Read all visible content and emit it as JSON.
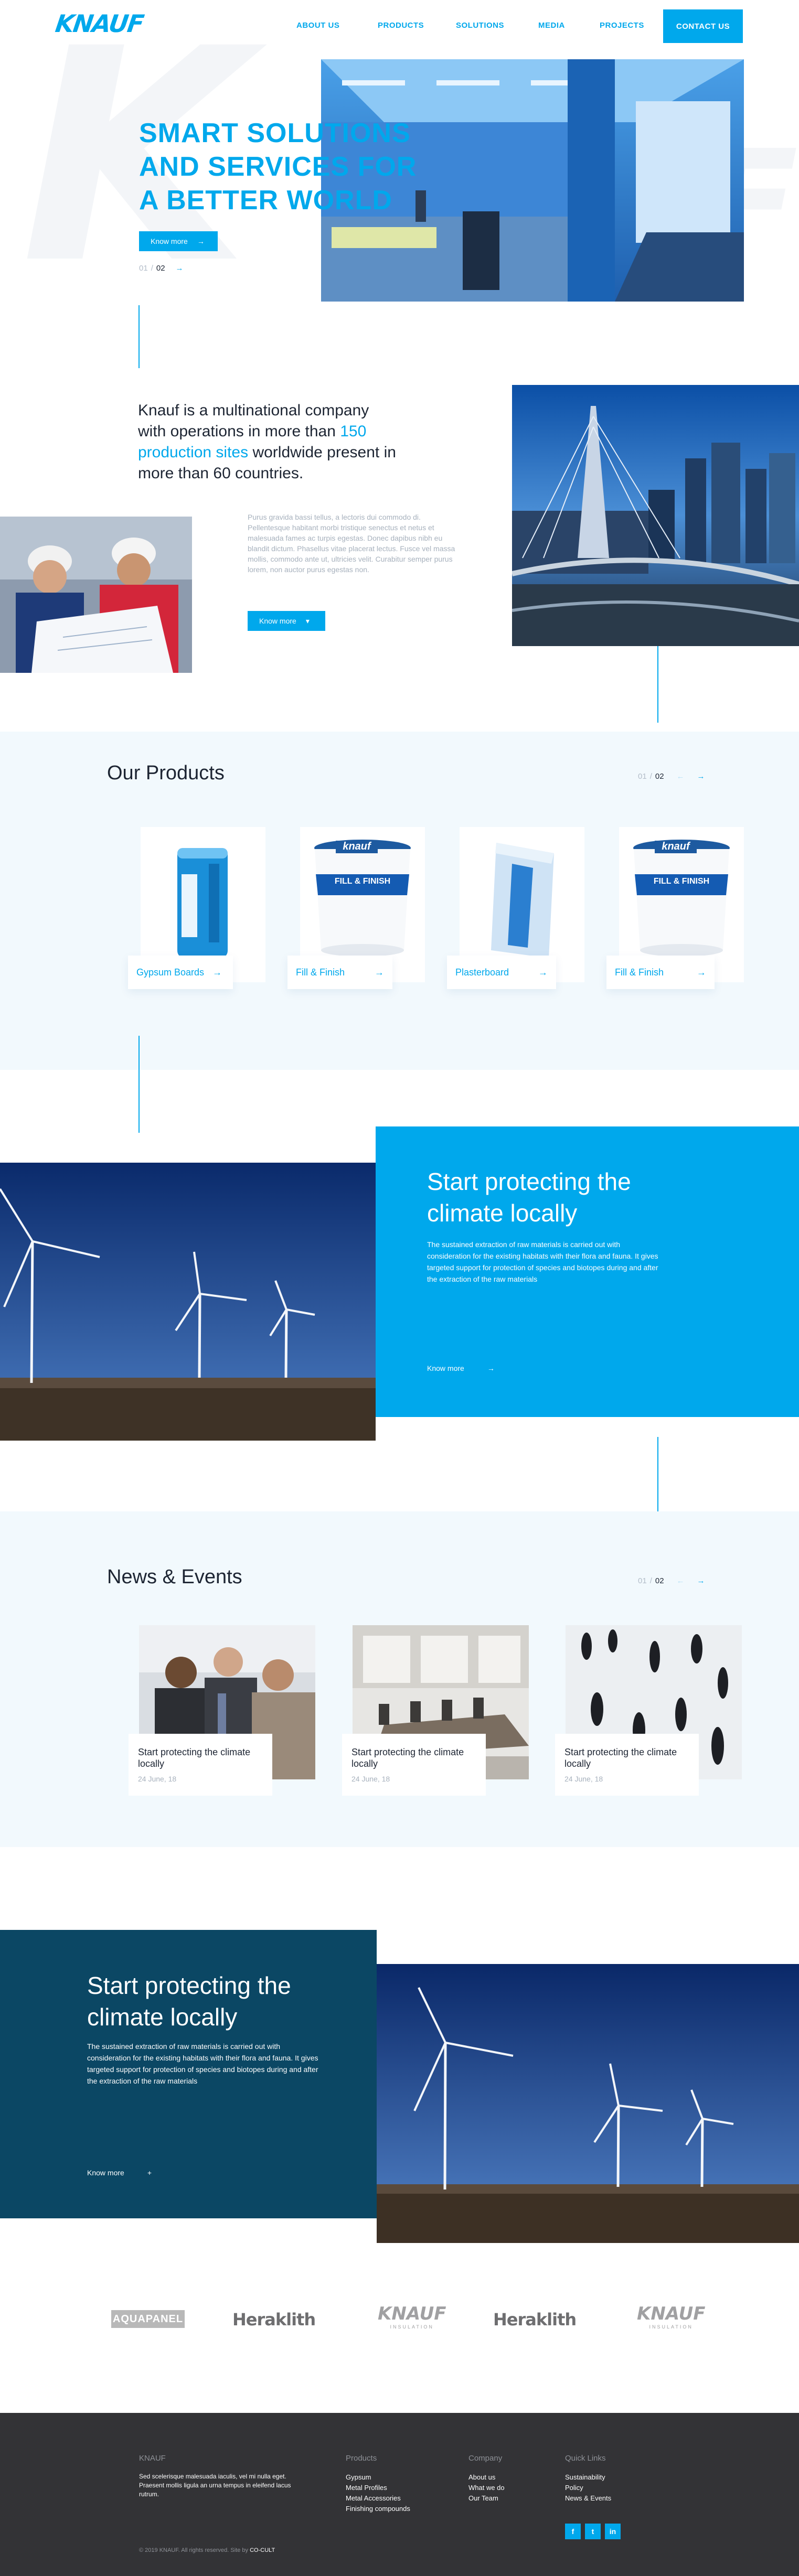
{
  "header": {
    "logo": "KNAUF",
    "nav": [
      "ABOUT US",
      "PRODUCTS",
      "SOLUTIONS",
      "MEDIA",
      "PROJECTS"
    ],
    "contact": "CONTACT US"
  },
  "hero": {
    "title": "SMART SOLUTIONS AND SERVICES FOR A BETTER WORLD",
    "button": "Know more",
    "pager_current": "01",
    "pager_total": "02"
  },
  "intro": {
    "text_before": "Knauf is a multinational company with operations in more than ",
    "highlight": "150 production sites",
    "text_after": " worldwide present in more than 60 countries.",
    "body": "Purus gravida bassi tellus, a lectoris dui commodo di. Pellentesque habitant morbi tristique senectus et netus et malesuada fames ac turpis egestas. Donec dapibus nibh eu blandit dictum. Phasellus vitae placerat lectus. Fusce vel massa mollis, commodo ante ut, ultricies velit. Curabitur semper purus lorem, non auctor purus egestas non.",
    "button": "Know more"
  },
  "products": {
    "title": "Our Products",
    "pager_current": "01",
    "pager_total": "02",
    "items": [
      {
        "label": "Gypsum Boards"
      },
      {
        "label": "Fill & Finish"
      },
      {
        "label": "Plasterboard"
      },
      {
        "label": "Fill & Finish"
      }
    ],
    "bucket_label": "FILL & FINISH",
    "bucket_brand": "knauf"
  },
  "climate1": {
    "title": "Start protecting the climate locally",
    "body": "The sustained extraction of raw materials is carried out with consideration for the existing habitats with their flora and fauna. It gives targeted support for protection of species and biotopes during and after the extraction of the raw materials",
    "link": "Know more"
  },
  "news": {
    "title": "News & Events",
    "pager_current": "01",
    "pager_total": "02",
    "items": [
      {
        "title": "Start protecting the climate locally",
        "date": "24 June, 18"
      },
      {
        "title": "Start protecting the climate locally",
        "date": "24 June, 18"
      },
      {
        "title": "Start protecting the climate locally",
        "date": "24 June, 18"
      }
    ]
  },
  "climate2": {
    "title": "Start protecting the climate locally",
    "body": "The sustained extraction of raw materials is carried out with consideration for the existing habitats with their flora and fauna. It gives targeted support for protection of species and biotopes during and after the extraction of the raw materials",
    "link": "Know more"
  },
  "brands": [
    "AQUAPANEL",
    "Heraklith",
    "KNAUF",
    "Heraklith",
    "KNAUF"
  ],
  "brands_sub": "INSULATION",
  "footer": {
    "brand": "KNAUF",
    "about": "Sed scelerisque malesuada iaculis, vel mi nulla eget. Praesent mollis ligula an urna tempus in eleifend lacus rutrum.",
    "products_h": "Products",
    "products": [
      "Gypsum",
      "Metal Profiles",
      "Metal Accessories",
      "Finishing compounds"
    ],
    "company_h": "Company",
    "company": [
      "About us",
      "What we do",
      "Our Team"
    ],
    "quick_h": "Quick Links",
    "quick": [
      "Sustainability",
      "Policy",
      "News & Events"
    ],
    "social": [
      "f",
      "t",
      "in"
    ],
    "copyright": "© 2019 KNAUF. All rights reserved. Site by ",
    "credit": "CO-CULT"
  },
  "colors": {
    "accent": "#00a8ec",
    "dark_teal": "#0b4764",
    "footer": "#333336",
    "panel": "#f2f9fd"
  }
}
